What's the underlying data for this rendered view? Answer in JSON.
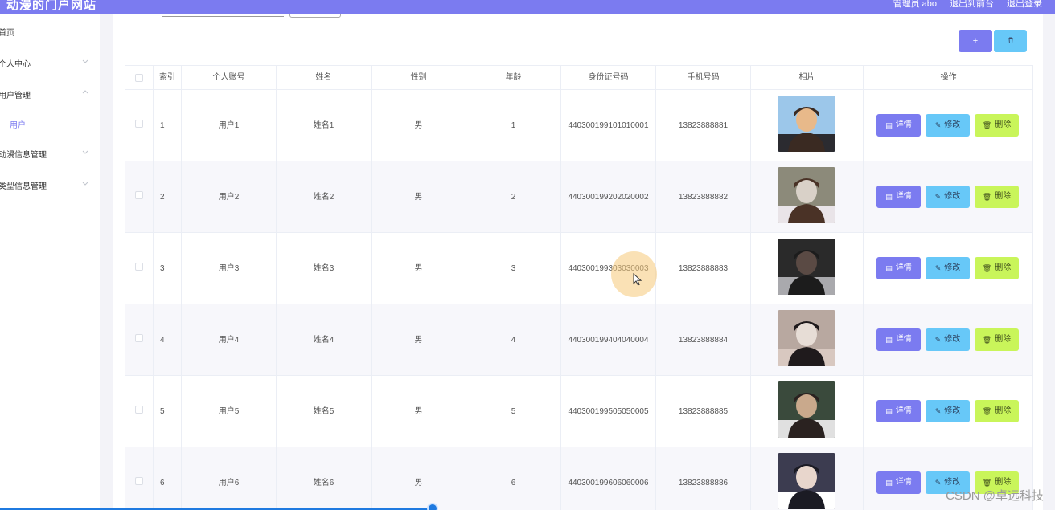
{
  "header": {
    "brand": "动漫的门户网站",
    "admin_label": "管理员 abo",
    "back_to_front": "退出到前台",
    "logout": "退出登录"
  },
  "sidebar": {
    "items": [
      {
        "label": "首页",
        "chevron": ""
      },
      {
        "label": "个人中心",
        "chevron": "chevron-down"
      },
      {
        "label": "用户管理",
        "chevron": "chevron-up"
      },
      {
        "label": "用户",
        "sub": true
      },
      {
        "label": "动漫信息管理",
        "chevron": "chevron-down"
      },
      {
        "label": "类型信息管理",
        "chevron": "chevron-down"
      }
    ]
  },
  "toolbar": {
    "add_icon": "+",
    "delete_icon": "🗑"
  },
  "table": {
    "headers": [
      "",
      "索引",
      "个人账号",
      "姓名",
      "性别",
      "年龄",
      "身份证号码",
      "手机号码",
      "相片",
      "操作"
    ],
    "rows": [
      {
        "index": "1",
        "account": "用户1",
        "name": "姓名1",
        "gender": "男",
        "age": "1",
        "id_no": "440300199101010001",
        "phone": "13823888881"
      },
      {
        "index": "2",
        "account": "用户2",
        "name": "姓名2",
        "gender": "男",
        "age": "2",
        "id_no": "440300199202020002",
        "phone": "13823888882"
      },
      {
        "index": "3",
        "account": "用户3",
        "name": "姓名3",
        "gender": "男",
        "age": "3",
        "id_no": "440300199303030003",
        "phone": "13823888883"
      },
      {
        "index": "4",
        "account": "用户4",
        "name": "姓名4",
        "gender": "男",
        "age": "4",
        "id_no": "440300199404040004",
        "phone": "13823888884"
      },
      {
        "index": "5",
        "account": "用户5",
        "name": "姓名5",
        "gender": "男",
        "age": "5",
        "id_no": "440300199505050005",
        "phone": "13823888885"
      },
      {
        "index": "6",
        "account": "用户6",
        "name": "姓名6",
        "gender": "男",
        "age": "6",
        "id_no": "440300199606060006",
        "phone": "13823888886"
      }
    ],
    "actions": {
      "detail": "详情",
      "edit": "修改",
      "delete": "删除"
    }
  },
  "watermark": "CSDN @卓远科技",
  "colors": {
    "primary": "#7b7bf0",
    "info": "#67c8f8",
    "success": "#c9f55a",
    "scroll": "#1f7ae0"
  }
}
